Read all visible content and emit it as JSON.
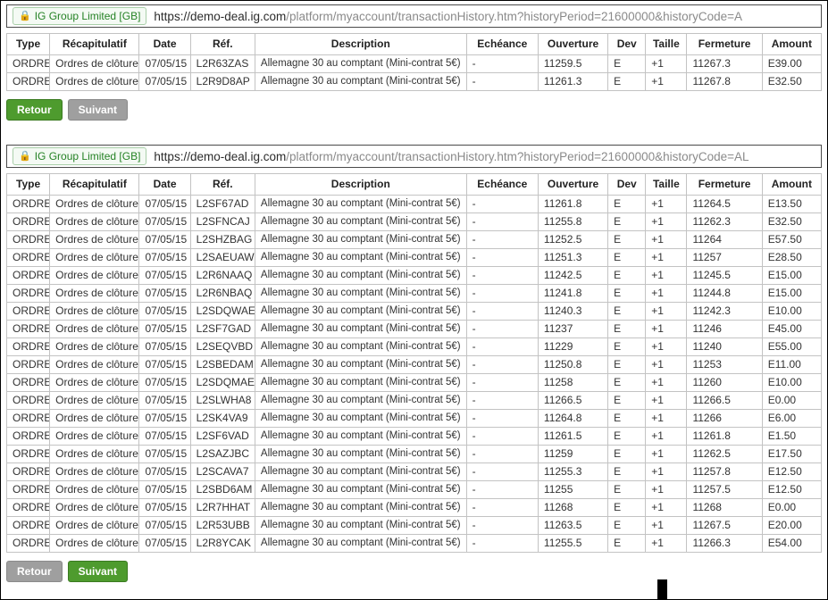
{
  "colors": {
    "accent_green": "#4e9b2e",
    "disabled_gray": "#9f9f9f",
    "badge_green": "#258225",
    "table_border": "#c3c3c3"
  },
  "panels": [
    {
      "urlbar": {
        "badge": "IG Group Limited [GB]",
        "scheme": "https://",
        "domain": "demo-deal.ig.com",
        "path": "/platform/myaccount/transactionHistory.htm?historyPeriod=21600000&historyCode=A"
      },
      "table": {
        "headers": [
          "Type",
          "Récapitulatif",
          "Date",
          "Réf.",
          "Description",
          "Echéance",
          "Ouverture",
          "Dev",
          "Taille",
          "Fermeture",
          "Amount"
        ],
        "rows": [
          [
            "ORDRE",
            "Ordres de clôture",
            "07/05/15",
            "L2R63ZAS",
            "Allemagne 30 au comptant (Mini-contrat 5€)",
            "-",
            "11259.5",
            "E",
            "+1",
            "11267.3",
            "E39.00"
          ],
          [
            "ORDRE",
            "Ordres de clôture",
            "07/05/15",
            "L2R9D8AP",
            "Allemagne 30 au comptant (Mini-contrat 5€)",
            "-",
            "11261.3",
            "E",
            "+1",
            "11267.8",
            "E32.50"
          ]
        ]
      },
      "buttons": [
        {
          "label": "Retour",
          "enabled": true
        },
        {
          "label": "Suivant",
          "enabled": false
        }
      ]
    },
    {
      "urlbar": {
        "badge": "IG Group Limited [GB]",
        "scheme": "https://",
        "domain": "demo-deal.ig.com",
        "path": "/platform/myaccount/transactionHistory.htm?historyPeriod=21600000&historyCode=AL"
      },
      "table": {
        "headers": [
          "Type",
          "Récapitulatif",
          "Date",
          "Réf.",
          "Description",
          "Echéance",
          "Ouverture",
          "Dev",
          "Taille",
          "Fermeture",
          "Amount"
        ],
        "rows": [
          [
            "ORDRE",
            "Ordres de clôture",
            "07/05/15",
            "L2SF67AD",
            "Allemagne 30 au comptant (Mini-contrat 5€)",
            "-",
            "11261.8",
            "E",
            "+1",
            "11264.5",
            "E13.50"
          ],
          [
            "ORDRE",
            "Ordres de clôture",
            "07/05/15",
            "L2SFNCAJ",
            "Allemagne 30 au comptant (Mini-contrat 5€)",
            "-",
            "11255.8",
            "E",
            "+1",
            "11262.3",
            "E32.50"
          ],
          [
            "ORDRE",
            "Ordres de clôture",
            "07/05/15",
            "L2SHZBAG",
            "Allemagne 30 au comptant (Mini-contrat 5€)",
            "-",
            "11252.5",
            "E",
            "+1",
            "11264",
            "E57.50"
          ],
          [
            "ORDRE",
            "Ordres de clôture",
            "07/05/15",
            "L2SAEUAW",
            "Allemagne 30 au comptant (Mini-contrat 5€)",
            "-",
            "11251.3",
            "E",
            "+1",
            "11257",
            "E28.50"
          ],
          [
            "ORDRE",
            "Ordres de clôture",
            "07/05/15",
            "L2R6NAAQ",
            "Allemagne 30 au comptant (Mini-contrat 5€)",
            "-",
            "11242.5",
            "E",
            "+1",
            "11245.5",
            "E15.00"
          ],
          [
            "ORDRE",
            "Ordres de clôture",
            "07/05/15",
            "L2R6NBAQ",
            "Allemagne 30 au comptant (Mini-contrat 5€)",
            "-",
            "11241.8",
            "E",
            "+1",
            "11244.8",
            "E15.00"
          ],
          [
            "ORDRE",
            "Ordres de clôture",
            "07/05/15",
            "L2SDQWAE",
            "Allemagne 30 au comptant (Mini-contrat 5€)",
            "-",
            "11240.3",
            "E",
            "+1",
            "11242.3",
            "E10.00"
          ],
          [
            "ORDRE",
            "Ordres de clôture",
            "07/05/15",
            "L2SF7GAD",
            "Allemagne 30 au comptant (Mini-contrat 5€)",
            "-",
            "11237",
            "E",
            "+1",
            "11246",
            "E45.00"
          ],
          [
            "ORDRE",
            "Ordres de clôture",
            "07/05/15",
            "L2SEQVBD",
            "Allemagne 30 au comptant (Mini-contrat 5€)",
            "-",
            "11229",
            "E",
            "+1",
            "11240",
            "E55.00"
          ],
          [
            "ORDRE",
            "Ordres de clôture",
            "07/05/15",
            "L2SBEDAM",
            "Allemagne 30 au comptant (Mini-contrat 5€)",
            "-",
            "11250.8",
            "E",
            "+1",
            "11253",
            "E11.00"
          ],
          [
            "ORDRE",
            "Ordres de clôture",
            "07/05/15",
            "L2SDQMAE",
            "Allemagne 30 au comptant (Mini-contrat 5€)",
            "-",
            "11258",
            "E",
            "+1",
            "11260",
            "E10.00"
          ],
          [
            "ORDRE",
            "Ordres de clôture",
            "07/05/15",
            "L2SLWHA8",
            "Allemagne 30 au comptant (Mini-contrat 5€)",
            "-",
            "11266.5",
            "E",
            "+1",
            "11266.5",
            "E0.00"
          ],
          [
            "ORDRE",
            "Ordres de clôture",
            "07/05/15",
            "L2SK4VA9",
            "Allemagne 30 au comptant (Mini-contrat 5€)",
            "-",
            "11264.8",
            "E",
            "+1",
            "11266",
            "E6.00"
          ],
          [
            "ORDRE",
            "Ordres de clôture",
            "07/05/15",
            "L2SF6VAD",
            "Allemagne 30 au comptant (Mini-contrat 5€)",
            "-",
            "11261.5",
            "E",
            "+1",
            "11261.8",
            "E1.50"
          ],
          [
            "ORDRE",
            "Ordres de clôture",
            "07/05/15",
            "L2SAZJBC",
            "Allemagne 30 au comptant (Mini-contrat 5€)",
            "-",
            "11259",
            "E",
            "+1",
            "11262.5",
            "E17.50"
          ],
          [
            "ORDRE",
            "Ordres de clôture",
            "07/05/15",
            "L2SCAVA7",
            "Allemagne 30 au comptant (Mini-contrat 5€)",
            "-",
            "11255.3",
            "E",
            "+1",
            "11257.8",
            "E12.50"
          ],
          [
            "ORDRE",
            "Ordres de clôture",
            "07/05/15",
            "L2SBD6AM",
            "Allemagne 30 au comptant (Mini-contrat 5€)",
            "-",
            "11255",
            "E",
            "+1",
            "11257.5",
            "E12.50"
          ],
          [
            "ORDRE",
            "Ordres de clôture",
            "07/05/15",
            "L2R7HHAT",
            "Allemagne 30 au comptant (Mini-contrat 5€)",
            "-",
            "11268",
            "E",
            "+1",
            "11268",
            "E0.00"
          ],
          [
            "ORDRE",
            "Ordres de clôture",
            "07/05/15",
            "L2R53UBB",
            "Allemagne 30 au comptant (Mini-contrat 5€)",
            "-",
            "11263.5",
            "E",
            "+1",
            "11267.5",
            "E20.00"
          ],
          [
            "ORDRE",
            "Ordres de clôture",
            "07/05/15",
            "L2R8YCAK",
            "Allemagne 30 au comptant (Mini-contrat 5€)",
            "-",
            "11255.5",
            "E",
            "+1",
            "11266.3",
            "E54.00"
          ]
        ]
      },
      "buttons": [
        {
          "label": "Retour",
          "enabled": false
        },
        {
          "label": "Suivant",
          "enabled": true
        }
      ]
    }
  ]
}
